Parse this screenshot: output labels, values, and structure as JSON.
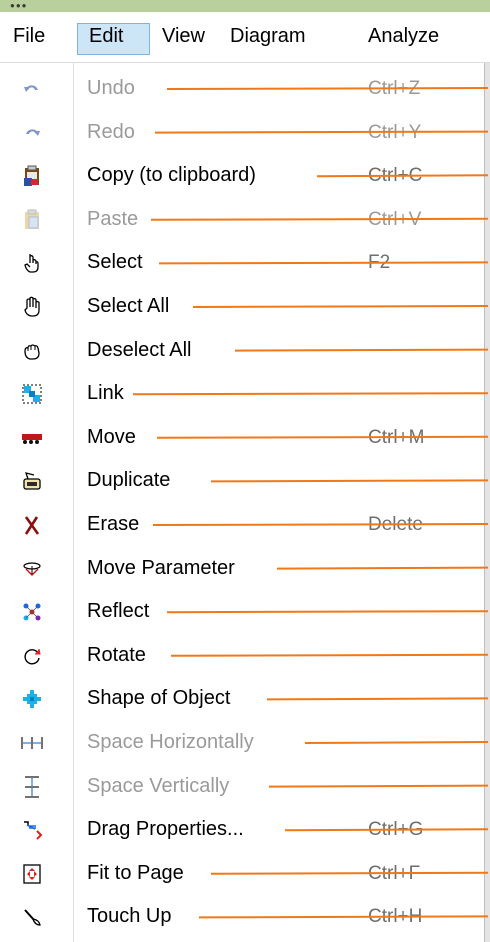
{
  "menubar": {
    "items": [
      {
        "label": "File"
      },
      {
        "label": "Edit"
      },
      {
        "label": "View"
      },
      {
        "label": "Diagram"
      },
      {
        "label": "Analyze"
      }
    ]
  },
  "edit_menu": {
    "items": [
      {
        "label": "Undo",
        "shortcut": "Ctrl+Z",
        "enabled": false,
        "icon": "undo-icon"
      },
      {
        "label": "Redo",
        "shortcut": "Ctrl+Y",
        "enabled": false,
        "icon": "redo-icon"
      },
      {
        "label": "Copy (to clipboard)",
        "shortcut": "Ctrl+C",
        "enabled": true,
        "icon": "clipboard-copy-icon"
      },
      {
        "label": "Paste",
        "shortcut": "Ctrl+V",
        "enabled": false,
        "icon": "paste-icon"
      },
      {
        "label": "Select",
        "shortcut": "F2",
        "enabled": true,
        "icon": "pointing-hand-icon"
      },
      {
        "label": "Select All",
        "shortcut": "",
        "enabled": true,
        "icon": "open-hand-icon"
      },
      {
        "label": "Deselect All",
        "shortcut": "",
        "enabled": true,
        "icon": "fist-hand-icon"
      },
      {
        "label": "Link",
        "shortcut": "",
        "enabled": true,
        "icon": "link-icon"
      },
      {
        "label": "Move",
        "shortcut": "Ctrl+M",
        "enabled": true,
        "icon": "move-truck-icon"
      },
      {
        "label": "Duplicate",
        "shortcut": "",
        "enabled": true,
        "icon": "duplicate-icon"
      },
      {
        "label": "Erase",
        "shortcut": "Delete",
        "enabled": true,
        "icon": "erase-x-icon"
      },
      {
        "label": "Move Parameter",
        "shortcut": "",
        "enabled": true,
        "icon": "move-parameter-icon"
      },
      {
        "label": "Reflect",
        "shortcut": "",
        "enabled": true,
        "icon": "reflect-icon"
      },
      {
        "label": "Rotate",
        "shortcut": "",
        "enabled": true,
        "icon": "rotate-icon"
      },
      {
        "label": "Shape of Object",
        "shortcut": "",
        "enabled": true,
        "icon": "shape-object-icon"
      },
      {
        "label": "Space Horizontally",
        "shortcut": "",
        "enabled": false,
        "icon": "space-horizontal-icon"
      },
      {
        "label": "Space Vertically",
        "shortcut": "",
        "enabled": false,
        "icon": "space-vertical-icon"
      },
      {
        "label": "Drag Properties...",
        "shortcut": "Ctrl+G",
        "enabled": true,
        "icon": "drag-properties-icon"
      },
      {
        "label": "Fit to Page",
        "shortcut": "Ctrl+F",
        "enabled": true,
        "icon": "fit-to-page-icon"
      },
      {
        "label": "Touch Up",
        "shortcut": "Ctrl+H",
        "enabled": true,
        "icon": "touch-up-brush-icon"
      }
    ]
  },
  "colors": {
    "leader_line": "#f07818",
    "menu_highlight": "#cde6f7",
    "title_strip": "#b9d09c"
  }
}
